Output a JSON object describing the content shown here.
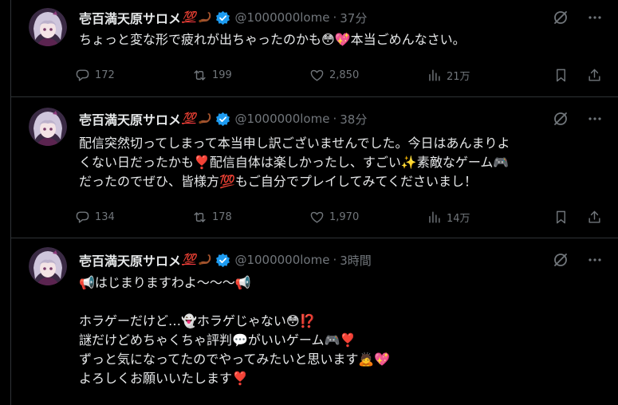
{
  "author": {
    "display_name": "壱百満天原サロメ",
    "emoji_100": "💯",
    "handle": "@1000000lome"
  },
  "tweets": [
    {
      "time": "37分",
      "lines": [
        "ちょっと変な形で疲れが出ちゃったのかも😳💖本当ごめんなさい。"
      ],
      "stats": {
        "replies": "172",
        "retweets": "199",
        "likes": "2,850",
        "views": "21万"
      }
    },
    {
      "time": "38分",
      "lines": [
        "配信突然切ってしまって本当申し訳ございませんでした。今日はあんまりよ",
        "くない日だったかも❣️配信自体は楽しかったし、すごい✨素敵なゲーム🎮",
        "だったのでぜひ、皆様方💯もご自分でプレイしてみてくださいまし！"
      ],
      "stats": {
        "replies": "134",
        "retweets": "178",
        "likes": "1,970",
        "views": "14万"
      }
    },
    {
      "time": "3時間",
      "lines": [
        "📢はじまりますわよ～～～📢",
        "",
        "ホラゲーだけど…👻ホラゲじゃない😳⁉️",
        "謎だけどめちゃくちゃ評判💬がいいゲーム🎮❣️",
        "ずっと気になってたのでやってみたいと思います🙇💖",
        "よろしくお願いいたします❣️"
      ]
    }
  ],
  "ui": {
    "separator": "·",
    "colors": {
      "background": "#000000",
      "text": "#e7e9ea",
      "muted": "#71767b",
      "verified": "#1d9bf0",
      "border": "#2f3336"
    }
  }
}
